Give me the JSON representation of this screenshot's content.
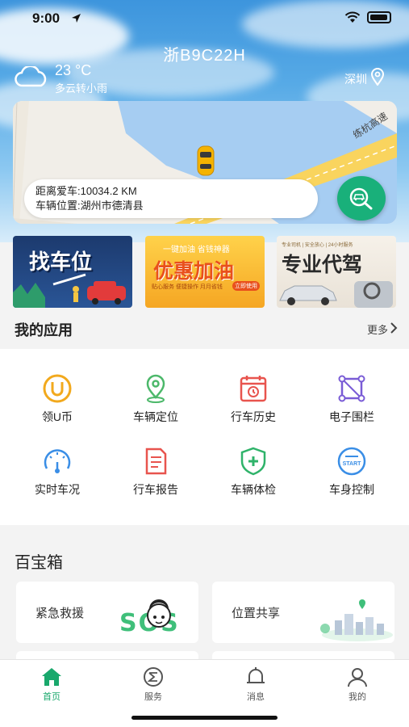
{
  "status_bar": {
    "time": "9:00"
  },
  "header": {
    "plate": "浙B9C22H",
    "temperature": "23 °C",
    "weather_desc": "多云转小雨",
    "city": "深圳"
  },
  "map": {
    "road_label": "练杭高速",
    "distance": "距离爱车:10034.2 KM",
    "location": "车辆位置:湖州市德清县"
  },
  "banners": [
    {
      "title": "找车位"
    },
    {
      "top": "一键加油  省钱神器",
      "title": "优惠加油",
      "sub": "贴心服务 便捷操作 月月省钱",
      "cta": "立即使用"
    },
    {
      "top": "专业司机 | 安全放心 | 24小时服务",
      "title": "专业代驾"
    }
  ],
  "apps_section": {
    "title": "我的应用",
    "more": "更多"
  },
  "apps": [
    {
      "label": "领U币",
      "icon": "u-coin-icon"
    },
    {
      "label": "车辆定位",
      "icon": "location-pin-icon"
    },
    {
      "label": "行车历史",
      "icon": "calendar-history-icon"
    },
    {
      "label": "电子围栏",
      "icon": "geofence-icon"
    },
    {
      "label": "实时车况",
      "icon": "speedometer-icon"
    },
    {
      "label": "行车报告",
      "icon": "report-document-icon"
    },
    {
      "label": "车辆体检",
      "icon": "shield-plus-icon"
    },
    {
      "label": "车身控制",
      "icon": "start-button-icon"
    }
  ],
  "toolbox": {
    "title": "百宝箱",
    "cards": [
      {
        "label": "紧急救援",
        "art": "SOS"
      },
      {
        "label": "位置共享"
      }
    ]
  },
  "tabbar": [
    {
      "label": "首页",
      "icon": "home-icon",
      "active": true
    },
    {
      "label": "服务",
      "icon": "service-icon"
    },
    {
      "label": "消息",
      "icon": "bell-icon"
    },
    {
      "label": "我的",
      "icon": "user-icon"
    }
  ],
  "colors": {
    "accent": "#19a86c",
    "locate_button": "#19b07a",
    "sky": "#3d95dd"
  }
}
